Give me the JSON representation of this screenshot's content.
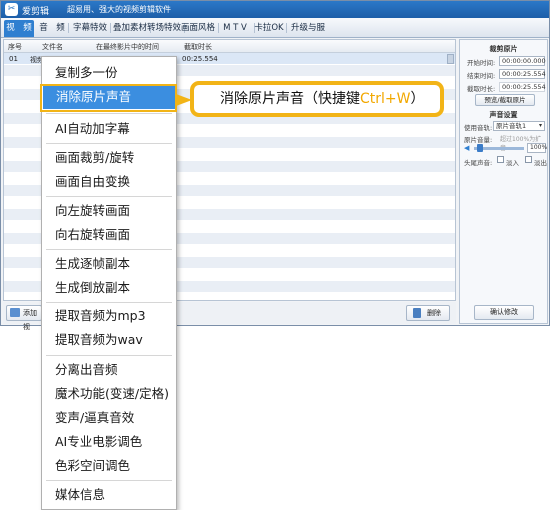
{
  "window": {
    "app_name": "爱剪辑",
    "slogan": "超易用、强大的视频剪辑软件"
  },
  "tabs": [
    {
      "label": "视　频",
      "active": true
    },
    {
      "label": "音　频"
    },
    {
      "label": "字幕特效"
    },
    {
      "label": "叠加素材"
    },
    {
      "label": "转场特效"
    },
    {
      "label": "画面风格"
    },
    {
      "label": "M T V"
    },
    {
      "label": "卡拉OK"
    },
    {
      "label": "升级与服务"
    }
  ],
  "list": {
    "columns": [
      "序号",
      "文件名",
      "在最终影片中的时间",
      "截取时长"
    ],
    "selected_row": {
      "index": "01",
      "name": "视频",
      "end": "00:25.554"
    }
  },
  "bottom_bar": {
    "add_label": "添加视",
    "delete_label": "删除"
  },
  "sidebar": {
    "clip_title": "裁剪原片",
    "start_label": "开始时间:",
    "start_value": "00:00:00.000",
    "end_label": "结束时间:",
    "end_value": "00:00:25.554",
    "duration_label": "截取时长:",
    "duration_value": "00:00:25.554",
    "preview_btn": "预览/截取原片",
    "audio_title": "声音设置",
    "track_label": "使用音轨:",
    "track_value": "原片音轨1",
    "volume_label": "原片音量:",
    "volume_hint": "超过100%为扩音",
    "volume_value": "100%",
    "fade_label": "头尾声音:",
    "fade_in": "淡入",
    "fade_out": "淡出",
    "confirm_btn": "确认修改"
  },
  "context_menu": {
    "items": [
      "复制多一份",
      "消除原片声音",
      "AI自动加字幕",
      "画面裁剪/旋转",
      "画面自由变换",
      "向左旋转画面",
      "向右旋转画面",
      "生成逐帧副本",
      "生成倒放副本",
      "提取音频为mp3",
      "提取音频为wav",
      "分离出音频",
      "魔术功能(变速/定格)",
      "变声/逼真音效",
      "AI专业电影调色",
      "色彩空间调色",
      "媒体信息"
    ]
  },
  "callout": {
    "text": "消除原片声音（快捷键",
    "shortcut": "Ctrl+W",
    "suffix": "）"
  },
  "colors": {
    "accent": "#2f7fd0",
    "highlight": "#3b8ee0",
    "callout": "#f2b417"
  }
}
